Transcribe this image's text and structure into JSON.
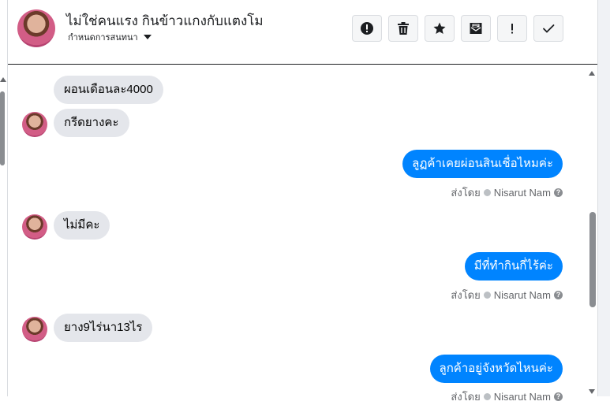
{
  "header": {
    "title": "ไม่ใช่คนแรง กินข้าวแกงกับแตงโม",
    "subtitle": "กำหนดการสนทนา"
  },
  "actions": [
    {
      "name": "report-button",
      "icon": "exclamation-circle-icon",
      "glyph": "!"
    },
    {
      "name": "delete-button",
      "icon": "trash-icon",
      "glyph": ""
    },
    {
      "name": "star-button",
      "icon": "star-icon",
      "glyph": "★"
    },
    {
      "name": "mark-unread-button",
      "icon": "envelope-icon",
      "glyph": ""
    },
    {
      "name": "important-button",
      "icon": "exclamation-icon",
      "glyph": "!"
    },
    {
      "name": "done-button",
      "icon": "checkmark-icon",
      "glyph": "✓"
    }
  ],
  "messages": [
    {
      "direction": "in",
      "text": "ผอนเดือนละ4000",
      "avatar": false
    },
    {
      "direction": "in",
      "text": "กรีดยางคะ",
      "avatar": true
    },
    {
      "direction": "out",
      "text": "ลูฏค้าเคยผ่อนสินเชื่อไหมค่ะ",
      "sent_by": "ส่งโดย",
      "sender": "Nisarut Nam"
    },
    {
      "direction": "in",
      "text": "ไม่มีคะ",
      "avatar": true
    },
    {
      "direction": "out",
      "text": "มีที่ทำกินกี่ไร้ค่ะ",
      "sent_by": "ส่งโดย",
      "sender": "Nisarut Nam"
    },
    {
      "direction": "in",
      "text": "ยาง9ไร่นา13ไร",
      "avatar": true
    },
    {
      "direction": "out",
      "text": "ลูกค้าอยู่จังหวัดไหนค่ะ",
      "sent_by": "ส่งโดย",
      "sender": "Nisarut Nam"
    }
  ],
  "colors": {
    "outgoing_bubble": "#0084ff",
    "incoming_bubble": "#e4e6eb",
    "text": "#1c1e21",
    "meta_text": "#65676b"
  }
}
